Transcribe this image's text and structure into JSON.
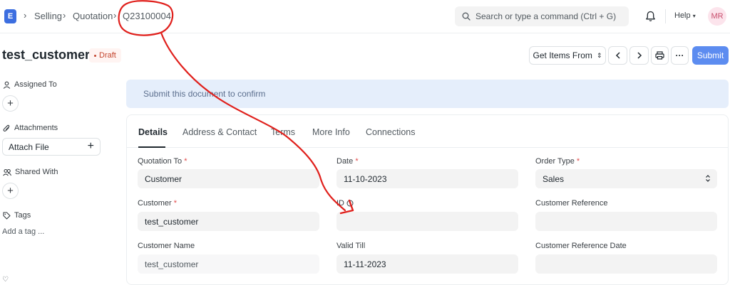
{
  "navbar": {
    "logo_letter": "E",
    "breadcrumbs": [
      "Selling",
      "Quotation",
      "Q23100004"
    ],
    "search_placeholder": "Search or type a command (Ctrl + G)",
    "help_label": "Help",
    "avatar_initials": "MR"
  },
  "page": {
    "title": "test_customer",
    "status": "Draft",
    "get_items_label": "Get Items From",
    "submit_label": "Submit"
  },
  "sidebar": {
    "assigned_to": "Assigned To",
    "attachments": "Attachments",
    "attach_file": "Attach File",
    "shared_with": "Shared With",
    "tags": "Tags",
    "add_tag": "Add a tag ..."
  },
  "alert": {
    "text": "Submit this document to confirm"
  },
  "tabs": [
    "Details",
    "Address & Contact",
    "Terms",
    "More Info",
    "Connections"
  ],
  "fields": {
    "quotation_to": {
      "label": "Quotation To",
      "required": "*",
      "value": "Customer"
    },
    "date": {
      "label": "Date",
      "required": "*",
      "value": "11-10-2023"
    },
    "order_type": {
      "label": "Order Type",
      "required": "*",
      "value": "Sales"
    },
    "customer": {
      "label": "Customer",
      "required": "*",
      "value": "test_customer"
    },
    "id": {
      "label": "ID",
      "value": ""
    },
    "customer_reference": {
      "label": "Customer Reference",
      "value": ""
    },
    "customer_name": {
      "label": "Customer Name",
      "value": "test_customer"
    },
    "valid_till": {
      "label": "Valid Till",
      "value": "11-11-2023"
    },
    "customer_reference_date": {
      "label": "Customer Reference Date",
      "value": ""
    }
  },
  "colors": {
    "primary": "#5c8cf0",
    "annotation": "#e0201c",
    "alert_bg": "#e5eefb",
    "draft": "#c4452e"
  }
}
